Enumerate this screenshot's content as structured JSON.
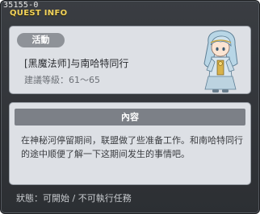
{
  "window": {
    "quest_id": "35155-0",
    "title": "QUEST INFO"
  },
  "info": {
    "category": "活動",
    "quest_name": "[黑魔法师]与南哈特同行",
    "level_label": "建議等級",
    "level_range": "61～65"
  },
  "npc": {
    "icon": "npc-character-portrait"
  },
  "content": {
    "header": "內容",
    "text": "在神秘河停留期间，联盟做了些准备工作。和南哈特同行的途中顺便了解一下这期间发生的事情吧。"
  },
  "status": {
    "label": "狀態",
    "value": "可開始 / 不可執行任務"
  },
  "colors": {
    "title": "#f2d35c",
    "panel": "#dde0e5",
    "badge": "#8e9298",
    "header": "#7c8087",
    "window": "#2c2f33"
  }
}
